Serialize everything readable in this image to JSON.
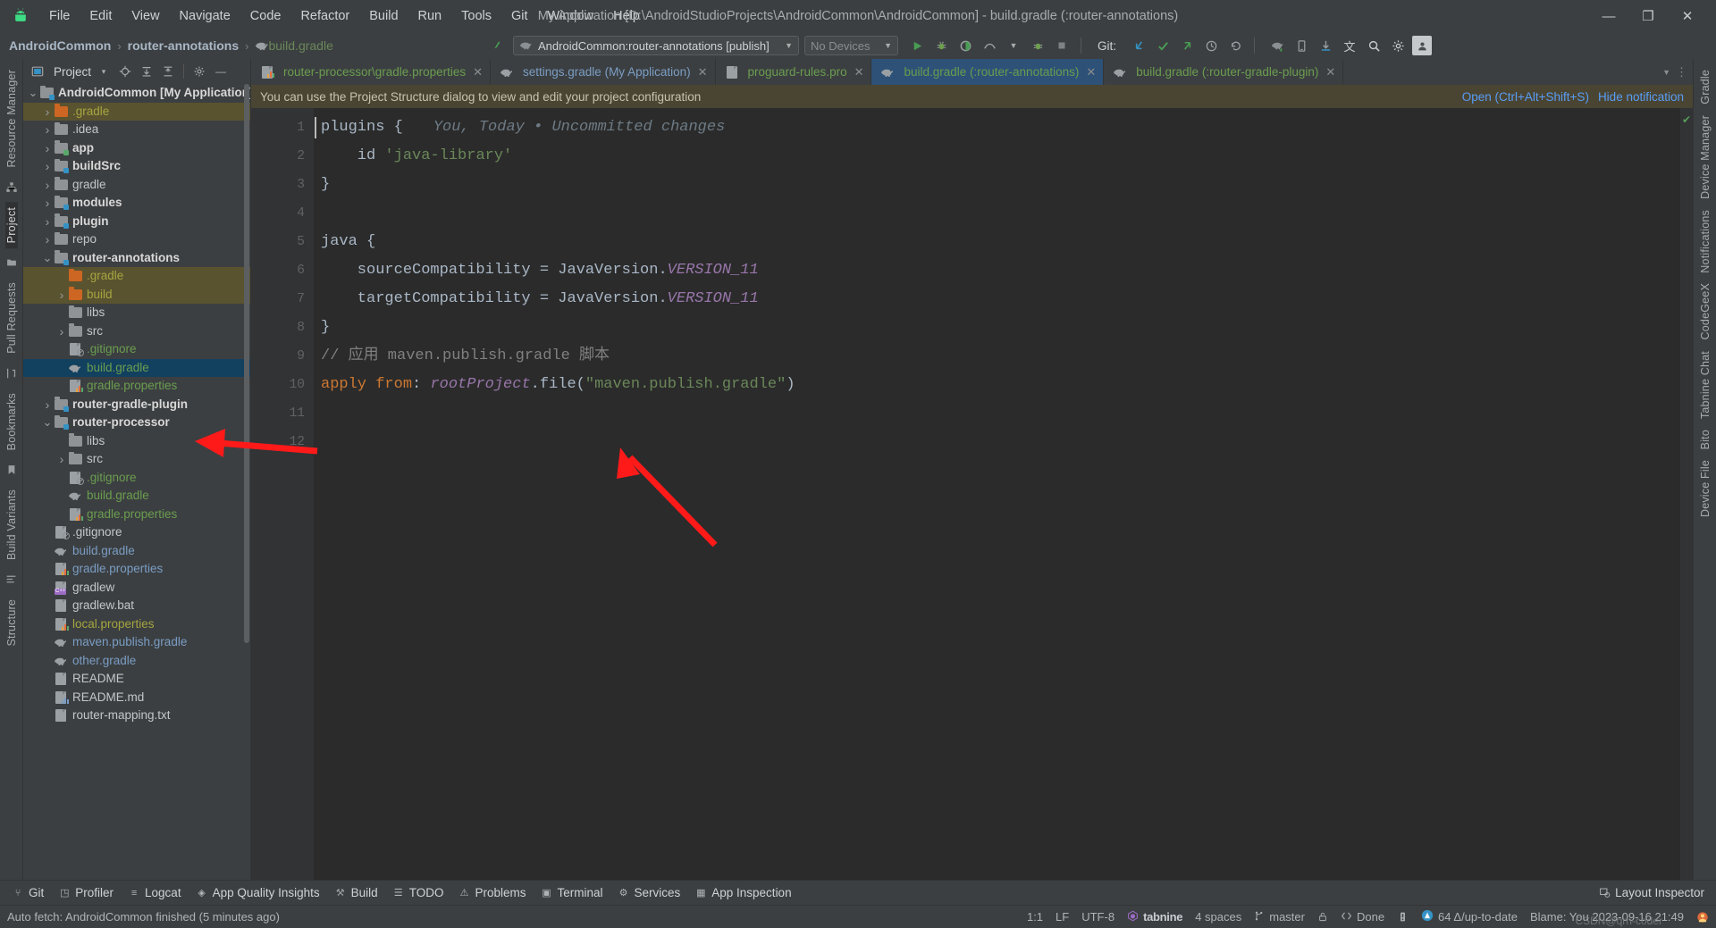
{
  "window": {
    "title": "My Application [D:\\AndroidStudioProjects\\AndroidCommon\\AndroidCommon] - build.gradle (:router-annotations)",
    "minimize": "—",
    "restore": "❐",
    "close": "✕"
  },
  "menu": {
    "items": [
      "File",
      "Edit",
      "View",
      "Navigate",
      "Code",
      "Refactor",
      "Build",
      "Run",
      "Tools",
      "Git",
      "Window",
      "Help"
    ]
  },
  "breadcrumb": {
    "project": "AndroidCommon",
    "module": "router-annotations",
    "file": "build.gradle",
    "separator": "›"
  },
  "toolbar": {
    "run_config": "AndroidCommon:router-annotations [publish]",
    "devices": "No Devices",
    "git_label": "Git:",
    "icons": [
      {
        "name": "run-icon",
        "glyph": "▶"
      },
      {
        "name": "debug-icon",
        "glyph": "⚙"
      },
      {
        "name": "run-coverage-icon",
        "glyph": "◑"
      },
      {
        "name": "profiler-icon",
        "glyph": "◔"
      },
      {
        "name": "attach-debugger-icon",
        "glyph": "↯"
      },
      {
        "name": "stop-icon",
        "glyph": "■"
      }
    ],
    "git_icons": [
      {
        "name": "update-project-icon",
        "glyph": "↙"
      },
      {
        "name": "commit-icon",
        "glyph": "✓"
      },
      {
        "name": "push-icon",
        "glyph": "↗"
      },
      {
        "name": "history-icon",
        "glyph": "◴"
      },
      {
        "name": "rollback-icon",
        "glyph": "↶"
      }
    ],
    "right_icons": [
      {
        "name": "gradle-sync-icon",
        "glyph": "⟳"
      },
      {
        "name": "device-manager-icon",
        "glyph": "⎕"
      },
      {
        "name": "sdk-manager-icon",
        "glyph": "⬇"
      },
      {
        "name": "translate-icon",
        "glyph": "文"
      },
      {
        "name": "search-everywhere-icon",
        "glyph": "⌕"
      },
      {
        "name": "settings-icon",
        "glyph": "⚙"
      },
      {
        "name": "account-icon",
        "glyph": "὆4"
      }
    ]
  },
  "left_rail": {
    "items": [
      "Resource Manager",
      "Project",
      "Pull Requests",
      "Bookmarks",
      "Build Variants",
      "Structure"
    ],
    "active": "Project"
  },
  "right_rail": {
    "items": [
      "Gradle",
      "Device Manager",
      "Notifications",
      "CodeGeeX",
      "Tabnine Chat",
      "Bito",
      "Device File"
    ]
  },
  "project_panel": {
    "title": "Project",
    "header_icons": [
      {
        "name": "project-view-dropdown-icon",
        "glyph": "▾"
      },
      {
        "name": "select-opened-file-icon",
        "glyph": "⌖"
      },
      {
        "name": "expand-all-icon",
        "glyph": "⤓"
      },
      {
        "name": "collapse-all-icon",
        "glyph": "⤒"
      },
      {
        "name": "panel-settings-icon",
        "glyph": "⚙"
      },
      {
        "name": "hide-panel-icon",
        "glyph": "—"
      }
    ],
    "tree": [
      {
        "label": "AndroidCommon [My Application]",
        "indent": 0,
        "arrow": "down",
        "icon": "folder-module",
        "style": "bold",
        "state": "normal"
      },
      {
        "label": ".gradle",
        "indent": 1,
        "arrow": "right",
        "icon": "folder-orange",
        "style": "yellow",
        "state": "highlight"
      },
      {
        "label": ".idea",
        "indent": 1,
        "arrow": "right",
        "icon": "folder-grey",
        "style": "normal",
        "state": "normal"
      },
      {
        "label": "app",
        "indent": 1,
        "arrow": "right",
        "icon": "folder-module-green",
        "style": "bold",
        "state": "normal"
      },
      {
        "label": "buildSrc",
        "indent": 1,
        "arrow": "right",
        "icon": "folder-module",
        "style": "bold",
        "state": "normal"
      },
      {
        "label": "gradle",
        "indent": 1,
        "arrow": "right",
        "icon": "folder-grey",
        "style": "normal",
        "state": "normal"
      },
      {
        "label": "modules",
        "indent": 1,
        "arrow": "right",
        "icon": "folder-module",
        "style": "bold",
        "state": "normal"
      },
      {
        "label": "plugin",
        "indent": 1,
        "arrow": "right",
        "icon": "folder-module",
        "style": "bold",
        "state": "normal"
      },
      {
        "label": "repo",
        "indent": 1,
        "arrow": "right",
        "icon": "folder-grey",
        "style": "normal",
        "state": "normal"
      },
      {
        "label": "router-annotations",
        "indent": 1,
        "arrow": "down",
        "icon": "folder-module",
        "style": "bold",
        "state": "normal"
      },
      {
        "label": ".gradle",
        "indent": 2,
        "arrow": "none",
        "icon": "folder-orange",
        "style": "yellow",
        "state": "highlight"
      },
      {
        "label": "build",
        "indent": 2,
        "arrow": "right",
        "icon": "folder-orange",
        "style": "yellow",
        "state": "highlight"
      },
      {
        "label": "libs",
        "indent": 2,
        "arrow": "none",
        "icon": "folder-grey",
        "style": "normal",
        "state": "normal"
      },
      {
        "label": "src",
        "indent": 2,
        "arrow": "right",
        "icon": "folder-grey",
        "style": "normal",
        "state": "normal"
      },
      {
        "label": ".gitignore",
        "indent": 2,
        "arrow": "none",
        "icon": "gitignore",
        "style": "green",
        "state": "normal"
      },
      {
        "label": "build.gradle",
        "indent": 2,
        "arrow": "none",
        "icon": "gradle",
        "style": "green",
        "state": "selected"
      },
      {
        "label": "gradle.properties",
        "indent": 2,
        "arrow": "none",
        "icon": "properties",
        "style": "green",
        "state": "normal"
      },
      {
        "label": "router-gradle-plugin",
        "indent": 1,
        "arrow": "right",
        "icon": "folder-module",
        "style": "bold",
        "state": "normal"
      },
      {
        "label": "router-processor",
        "indent": 1,
        "arrow": "down",
        "icon": "folder-module",
        "style": "bold",
        "state": "normal"
      },
      {
        "label": "libs",
        "indent": 2,
        "arrow": "none",
        "icon": "folder-grey",
        "style": "normal",
        "state": "normal"
      },
      {
        "label": "src",
        "indent": 2,
        "arrow": "right",
        "icon": "folder-grey",
        "style": "normal",
        "state": "normal"
      },
      {
        "label": ".gitignore",
        "indent": 2,
        "arrow": "none",
        "icon": "gitignore",
        "style": "green",
        "state": "normal"
      },
      {
        "label": "build.gradle",
        "indent": 2,
        "arrow": "none",
        "icon": "gradle",
        "style": "green",
        "state": "normal"
      },
      {
        "label": "gradle.properties",
        "indent": 2,
        "arrow": "none",
        "icon": "properties",
        "style": "green",
        "state": "normal"
      },
      {
        "label": ".gitignore",
        "indent": 1,
        "arrow": "none",
        "icon": "gitignore",
        "style": "normal",
        "state": "normal"
      },
      {
        "label": "build.gradle",
        "indent": 1,
        "arrow": "none",
        "icon": "gradle",
        "style": "blue",
        "state": "normal"
      },
      {
        "label": "gradle.properties",
        "indent": 1,
        "arrow": "none",
        "icon": "properties",
        "style": "blue",
        "state": "normal"
      },
      {
        "label": "gradlew",
        "indent": 1,
        "arrow": "none",
        "icon": "script-cpp",
        "style": "normal",
        "state": "normal"
      },
      {
        "label": "gradlew.bat",
        "indent": 1,
        "arrow": "none",
        "icon": "file",
        "style": "normal",
        "state": "normal"
      },
      {
        "label": "local.properties",
        "indent": 1,
        "arrow": "none",
        "icon": "properties",
        "style": "yellow",
        "state": "normal"
      },
      {
        "label": "maven.publish.gradle",
        "indent": 1,
        "arrow": "none",
        "icon": "gradle",
        "style": "blue",
        "state": "normal"
      },
      {
        "label": "other.gradle",
        "indent": 1,
        "arrow": "none",
        "icon": "gradle",
        "style": "blue",
        "state": "normal"
      },
      {
        "label": "README",
        "indent": 1,
        "arrow": "none",
        "icon": "file",
        "style": "normal",
        "state": "normal"
      },
      {
        "label": "README.md",
        "indent": 1,
        "arrow": "none",
        "icon": "markdown",
        "style": "normal",
        "state": "normal"
      },
      {
        "label": "router-mapping.txt",
        "indent": 1,
        "arrow": "none",
        "icon": "file",
        "style": "normal",
        "state": "normal"
      }
    ]
  },
  "tabs": [
    {
      "label": "router-processor\\gradle.properties",
      "icon": "properties",
      "color": "green",
      "active": false
    },
    {
      "label": "settings.gradle (My Application)",
      "icon": "gradle",
      "color": "blue",
      "active": false
    },
    {
      "label": "proguard-rules.pro",
      "icon": "file",
      "color": "green",
      "active": false
    },
    {
      "label": "build.gradle (:router-annotations)",
      "icon": "gradle",
      "color": "green",
      "active": true
    },
    {
      "label": "build.gradle (:router-gradle-plugin)",
      "icon": "gradle",
      "color": "green",
      "active": false
    }
  ],
  "notification": {
    "message": "You can use the Project Structure dialog to view and edit your project configuration",
    "action": "Open (Ctrl+Alt+Shift+S)",
    "dismiss": "Hide notification"
  },
  "editor": {
    "line_numbers": [
      "1",
      "2",
      "3",
      "4",
      "5",
      "6",
      "7",
      "8",
      "9",
      "10",
      "11",
      "12"
    ],
    "inlay_hint": "You, Today • Uncommitted changes",
    "lines": [
      {
        "n": 1,
        "tokens": [
          {
            "t": "plugins",
            "c": "plain"
          },
          {
            "t": " {",
            "c": "plain"
          }
        ]
      },
      {
        "n": 2,
        "tokens": [
          {
            "t": "    id ",
            "c": "plain"
          },
          {
            "t": "'java-library'",
            "c": "str"
          }
        ]
      },
      {
        "n": 3,
        "tokens": [
          {
            "t": "}",
            "c": "plain"
          }
        ]
      },
      {
        "n": 4,
        "tokens": []
      },
      {
        "n": 5,
        "tokens": [
          {
            "t": "java {",
            "c": "plain"
          }
        ]
      },
      {
        "n": 6,
        "tokens": [
          {
            "t": "    sourceCompatibility = JavaVersion.",
            "c": "plain"
          },
          {
            "t": "VERSION_11",
            "c": "fld"
          }
        ]
      },
      {
        "n": 7,
        "tokens": [
          {
            "t": "    targetCompatibility = JavaVersion.",
            "c": "plain"
          },
          {
            "t": "VERSION_11",
            "c": "fld"
          }
        ]
      },
      {
        "n": 8,
        "tokens": [
          {
            "t": "}",
            "c": "plain"
          }
        ]
      },
      {
        "n": 9,
        "tokens": [
          {
            "t": "// 应用 maven.publish.gradle 脚本",
            "c": "cmt"
          }
        ]
      },
      {
        "n": 10,
        "tokens": [
          {
            "t": "apply",
            "c": "kw"
          },
          {
            "t": " ",
            "c": "plain"
          },
          {
            "t": "from",
            "c": "kw"
          },
          {
            "t": ": ",
            "c": "plain"
          },
          {
            "t": "rootProject",
            "c": "fld"
          },
          {
            "t": ".file(",
            "c": "plain"
          },
          {
            "t": "\"maven.publish.gradle\"",
            "c": "str"
          },
          {
            "t": ")",
            "c": "plain"
          }
        ]
      },
      {
        "n": 11,
        "tokens": []
      },
      {
        "n": 12,
        "tokens": []
      }
    ]
  },
  "bottom_tools": [
    {
      "label": "Git",
      "icon": "git-icon"
    },
    {
      "label": "Profiler",
      "icon": "profiler-icon"
    },
    {
      "label": "Logcat",
      "icon": "logcat-icon"
    },
    {
      "label": "App Quality Insights",
      "icon": "insights-icon"
    },
    {
      "label": "Build",
      "icon": "build-icon"
    },
    {
      "label": "TODO",
      "icon": "todo-icon"
    },
    {
      "label": "Problems",
      "icon": "problems-icon"
    },
    {
      "label": "Terminal",
      "icon": "terminal-icon"
    },
    {
      "label": "Services",
      "icon": "services-icon"
    },
    {
      "label": "App Inspection",
      "icon": "app-inspection-icon"
    }
  ],
  "bottom_right": {
    "layout_inspector": "Layout Inspector"
  },
  "statusbar": {
    "message": "Auto fetch: AndroidCommon finished (5 minutes ago)",
    "caret": "1:1",
    "line_sep": "LF",
    "encoding": "UTF-8",
    "tabnine": "tabnine",
    "indent": "4 spaces",
    "branch": "master",
    "lock": "read-only-toggle",
    "done": "Done",
    "delta": "64 Δ/up-to-date",
    "blame": "Blame: You 2023-09-16 21:49",
    "watermark": "CSDN@qrn-coder"
  }
}
